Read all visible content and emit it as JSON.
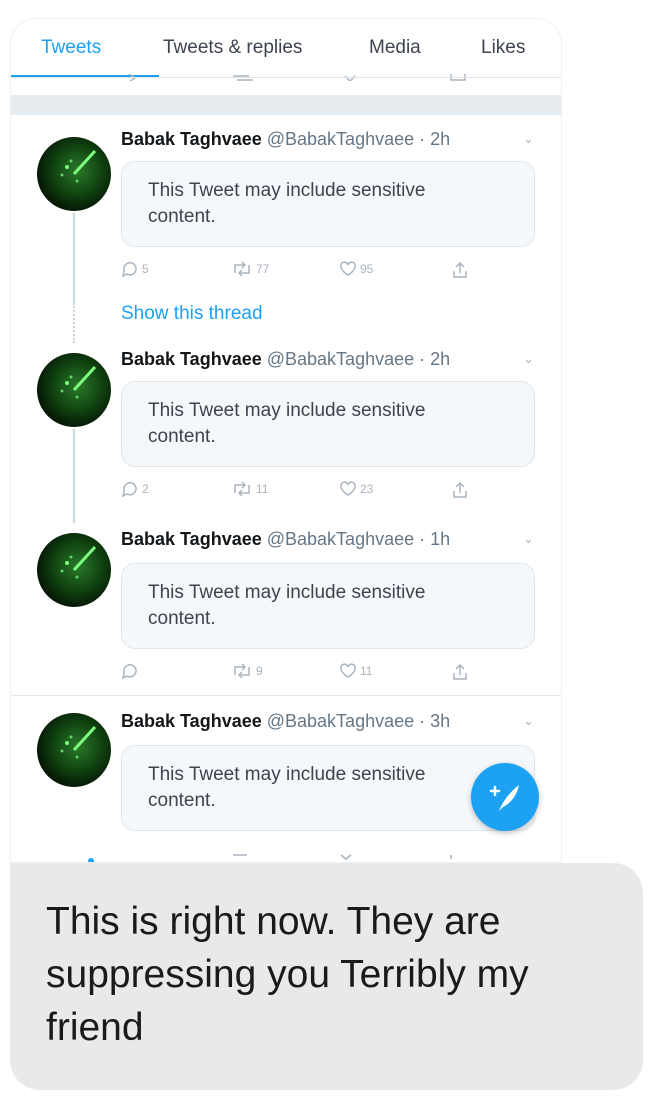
{
  "tabs": [
    {
      "label": "Tweets",
      "active": true
    },
    {
      "label": "Tweets & replies",
      "active": false
    },
    {
      "label": "Media",
      "active": false
    },
    {
      "label": "Likes",
      "active": false
    }
  ],
  "tweets": [
    {
      "name": "Babak Taghvaee",
      "handle": "@BabakTaghvaee",
      "time": "2h",
      "content": "This Tweet may include sensitive content.",
      "replies": "5",
      "retweets": "77",
      "likes": "95"
    },
    {
      "name": "Babak Taghvaee",
      "handle": "@BabakTaghvaee",
      "time": "2h",
      "content": "This Tweet may include sensitive content.",
      "replies": "2",
      "retweets": "11",
      "likes": "23"
    },
    {
      "name": "Babak Taghvaee",
      "handle": "@BabakTaghvaee",
      "time": "1h",
      "content": "This Tweet may include sensitive content.",
      "replies": "",
      "retweets": "9",
      "likes": "11"
    },
    {
      "name": "Babak Taghvaee",
      "handle": "@BabakTaghvaee",
      "time": "3h",
      "content": "This Tweet may include sensitive content."
    }
  ],
  "show_thread_label": "Show this thread",
  "message": {
    "text": "This is right now. They are suppressing you Terribly my friend"
  },
  "colors": {
    "accent": "#1da1f2",
    "bubble": "#e8e9eb"
  },
  "icons": {
    "compose": "compose-tweet-icon",
    "reply": "reply-icon",
    "retweet": "retweet-icon",
    "like": "heart-icon",
    "share": "share-icon",
    "chevron": "chevron-down-icon"
  }
}
